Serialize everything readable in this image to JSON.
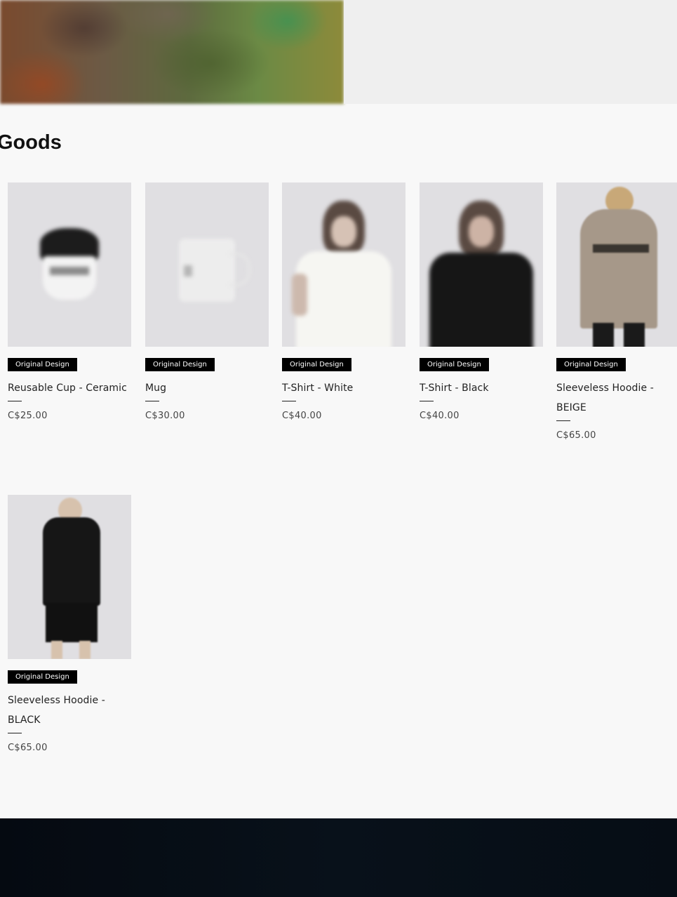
{
  "section": {
    "title": "Goods"
  },
  "products": [
    {
      "badge": "Original Design",
      "name": "Reusable Cup - Ceramic",
      "price": "C$25.00",
      "image_icon": "cup-photo"
    },
    {
      "badge": "Original Design",
      "name": "Mug",
      "price": "C$30.00",
      "image_icon": "mug-photo"
    },
    {
      "badge": "Original Design",
      "name": "T-Shirt - White",
      "price": "C$40.00",
      "image_icon": "white-tshirt-photo"
    },
    {
      "badge": "Original Design",
      "name": "T-Shirt - Black",
      "price": "C$40.00",
      "image_icon": "black-tshirt-photo"
    },
    {
      "badge": "Original Design",
      "name": "Sleeveless Hoodie - BEIGE",
      "price": "C$65.00",
      "image_icon": "beige-hoodie-photo"
    },
    {
      "badge": "Original Design",
      "name": "Sleeveless Hoodie - BLACK",
      "price": "C$65.00",
      "image_icon": "black-hoodie-photo"
    }
  ],
  "colors": {
    "background": "#f8f8f8",
    "badge": "#000000",
    "footer": "#050a11"
  }
}
